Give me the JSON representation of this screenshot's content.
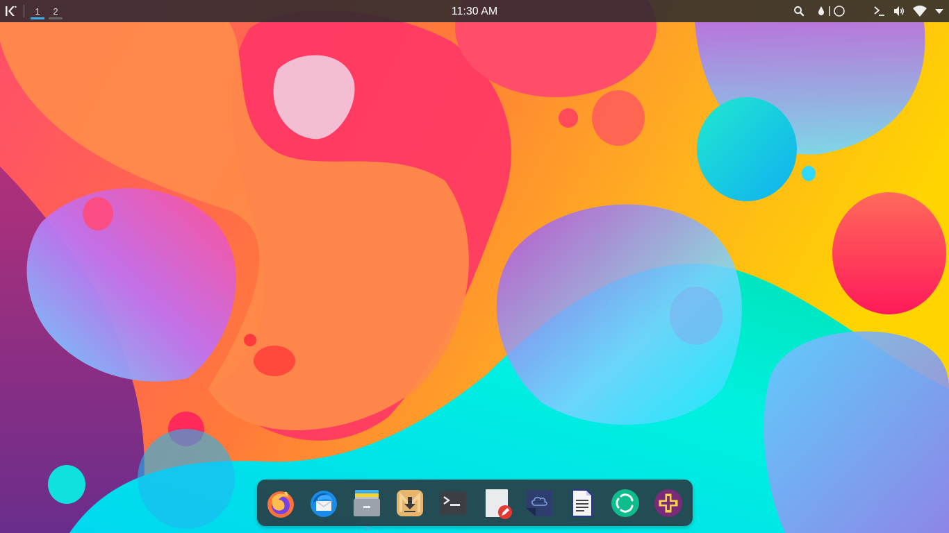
{
  "panel": {
    "virtual_desktops": [
      {
        "label": "1",
        "active": true
      },
      {
        "label": "2",
        "active": false
      }
    ],
    "clock": "11:30 AM",
    "tray_icons": [
      "search-icon",
      "night-color-icon",
      "theme-toggle-icon",
      "terminal-tray-icon",
      "volume-icon",
      "wifi-icon",
      "expand-tray-icon"
    ]
  },
  "dock": {
    "apps": [
      {
        "icon": "firefox-icon",
        "running": false
      },
      {
        "icon": "thunderbird-icon",
        "running": false
      },
      {
        "icon": "file-manager-icon",
        "running": true
      },
      {
        "icon": "download-manager-icon",
        "running": false
      },
      {
        "icon": "terminal-icon",
        "running": false
      },
      {
        "icon": "text-editor-icon",
        "running": false
      },
      {
        "icon": "cloud-icon",
        "running": false
      },
      {
        "icon": "document-writer-icon",
        "running": false
      },
      {
        "icon": "element-chat-icon",
        "running": false
      },
      {
        "icon": "plus-app-icon",
        "running": false
      }
    ]
  },
  "colors": {
    "panel_bg": "#2d2a2e",
    "accent": "#3daee9",
    "dock_bg": "#283740"
  }
}
